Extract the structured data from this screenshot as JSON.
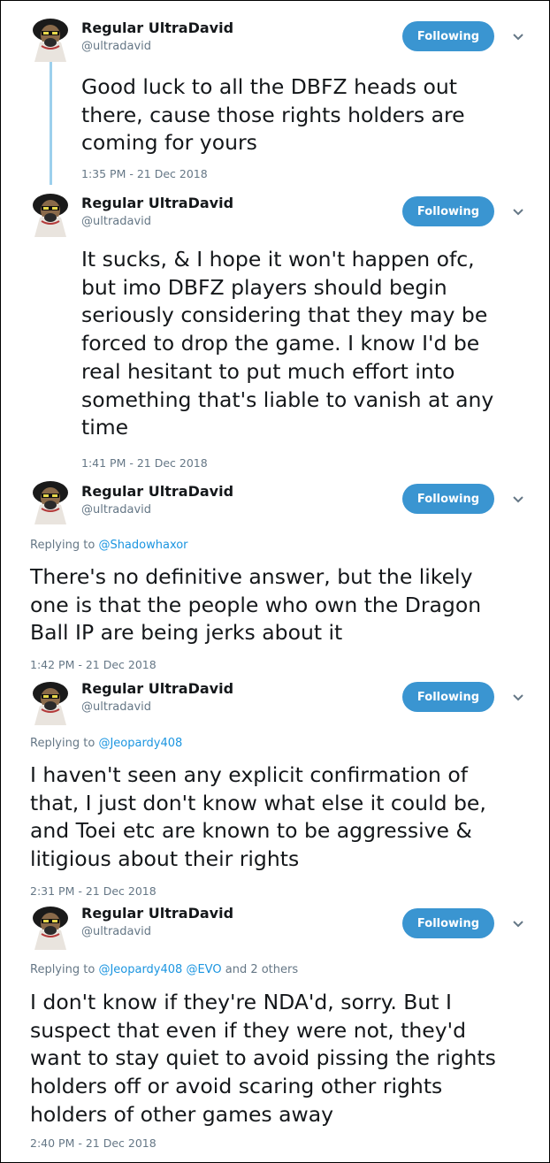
{
  "tweets": [
    {
      "name": "Regular UltraDavid",
      "handle": "@ultradavid",
      "follow_label": "Following",
      "reply": null,
      "lines": [
        "Good luck to all the DBFZ heads out",
        "there, cause those rights holders are",
        "coming for yours"
      ],
      "time": "1:35 PM - 21 Dec 2018"
    },
    {
      "name": "Regular UltraDavid",
      "handle": "@ultradavid",
      "follow_label": "Following",
      "reply": null,
      "lines": [
        "It sucks, & I hope it won't happen ofc,",
        "but imo DBFZ players should begin",
        "seriously considering that they may be",
        "forced to drop the game. I know I'd be",
        "real hesitant to put much effort into",
        "something that's liable to vanish at any",
        "time"
      ],
      "time": "1:41 PM - 21 Dec 2018"
    },
    {
      "name": "Regular UltraDavid",
      "handle": "@ultradavid",
      "follow_label": "Following",
      "reply": {
        "prefix": "Replying to",
        "users": [
          "@Shadowhaxor"
        ],
        "suffix": ""
      },
      "lines": [
        "There's no definitive answer, but the likely",
        "one is that the people who own the Dragon",
        "Ball IP are being jerks about it"
      ],
      "time": "1:42 PM - 21 Dec 2018"
    },
    {
      "name": "Regular UltraDavid",
      "handle": "@ultradavid",
      "follow_label": "Following",
      "reply": {
        "prefix": "Replying to",
        "users": [
          "@Jeopardy408"
        ],
        "suffix": ""
      },
      "lines": [
        "I haven't seen any explicit confirmation of",
        "that, I just don't know what else it could be,",
        "and Toei etc are known to be aggressive &",
        "litigious about their rights"
      ],
      "time": "2:31 PM - 21 Dec 2018"
    },
    {
      "name": "Regular UltraDavid",
      "handle": "@ultradavid",
      "follow_label": "Following",
      "reply": {
        "prefix": "Replying to",
        "users": [
          "@Jeopardy408",
          "@EVO"
        ],
        "suffix": "and 2 others"
      },
      "lines": [
        "I don't know if they're NDA'd, sorry. But I",
        "suspect that even if they were not, they'd",
        "want to stay quiet to avoid pissing the rights",
        "holders off or avoid scaring other rights",
        "holders of other games away"
      ],
      "time": "2:40 PM - 21 Dec 2018"
    }
  ],
  "colors": {
    "follow_button": "#3a95d1",
    "link": "#1b95e0",
    "secondary_text": "#657786",
    "thread_line": "#9cd0ed"
  },
  "icons": {
    "avatar": "avatar-figure",
    "more": "chevron-down-icon"
  }
}
